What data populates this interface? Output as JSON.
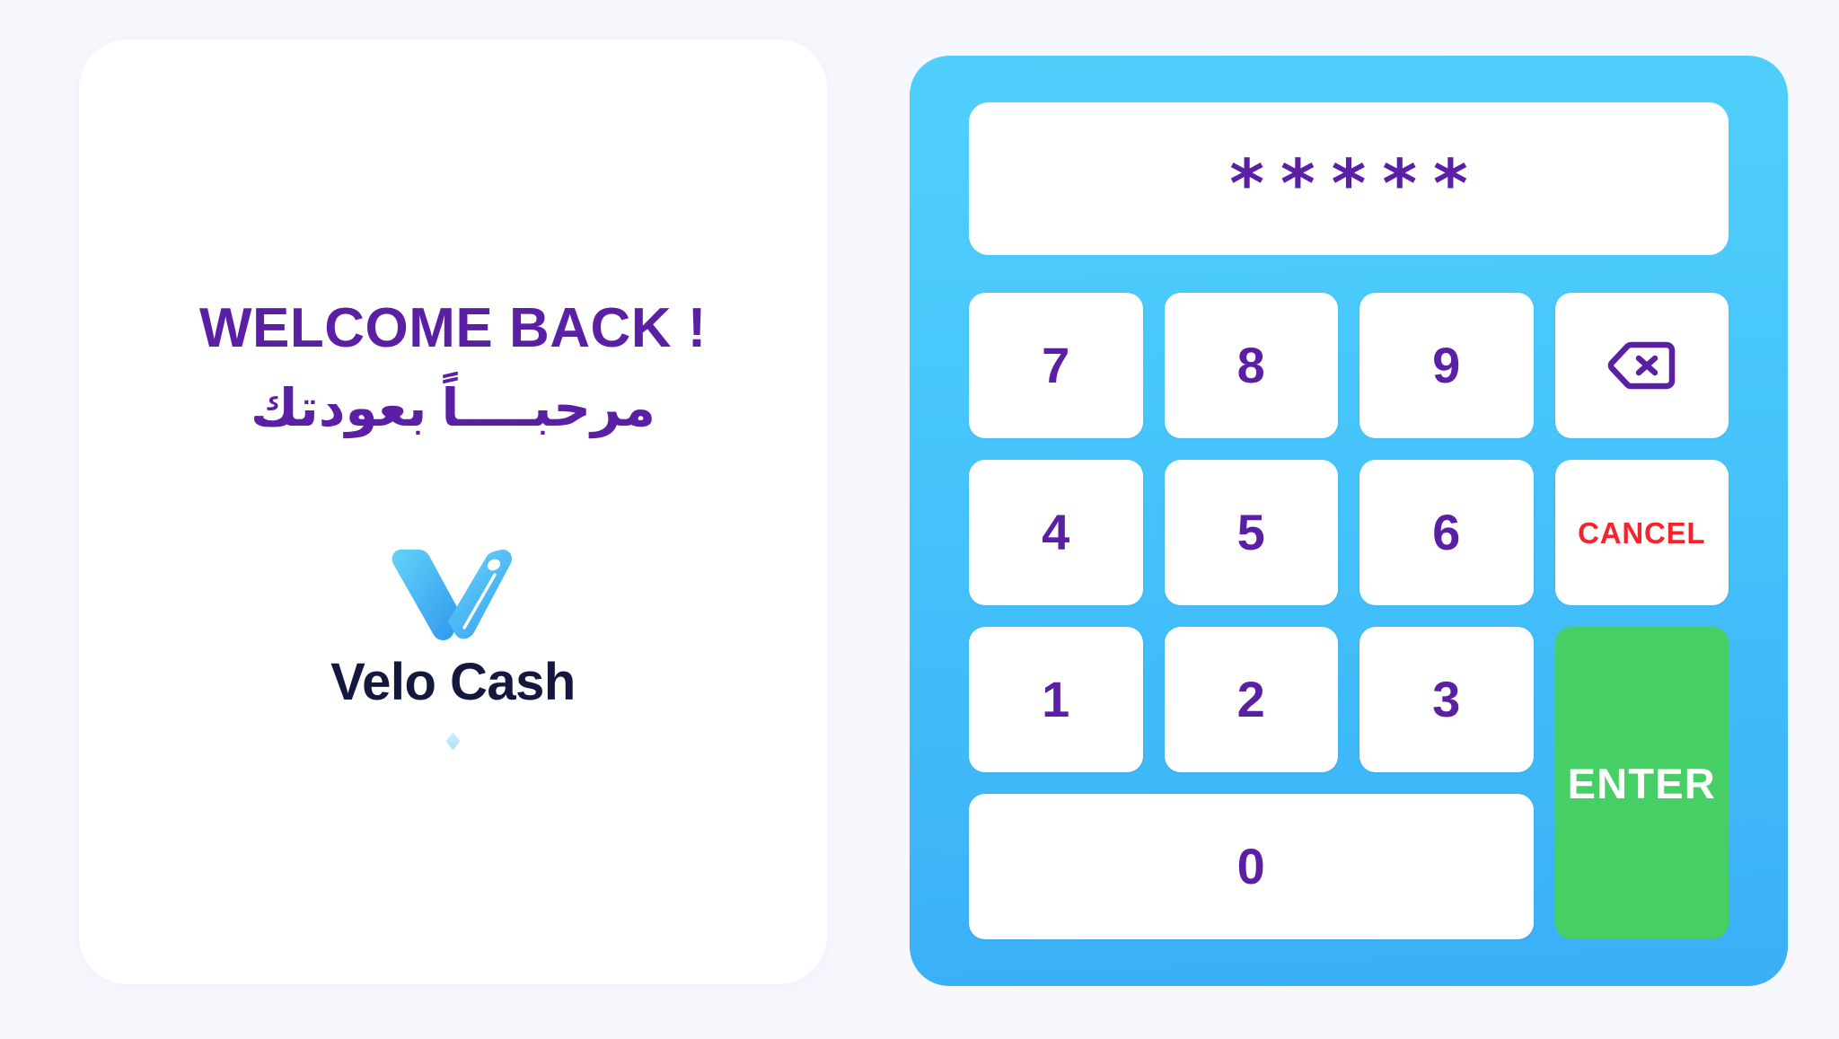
{
  "app": {
    "background_color": "#f6f8fd",
    "brand_purple": "#5b1fa6",
    "panel_blue_top": "#51cffb",
    "panel_blue_bottom": "#3aaff7",
    "enter_green": "#45cf65",
    "cancel_red": "#f4232c",
    "brand_navy": "#14183c"
  },
  "welcome": {
    "title_en": "WELCOME BACK !",
    "title_ar": "مرحبــــاً بعودتك",
    "brand_name": "Velo Cash",
    "logo_icon": "velo-v-wallet-icon"
  },
  "keypad": {
    "pin_display": {
      "masked_value": "*****",
      "digit_count": 5
    },
    "keys": [
      {
        "id": "key-7",
        "label": "7",
        "type": "digit"
      },
      {
        "id": "key-8",
        "label": "8",
        "type": "digit"
      },
      {
        "id": "key-9",
        "label": "9",
        "type": "digit"
      },
      {
        "id": "key-backspace",
        "label": "",
        "type": "backspace",
        "icon": "backspace-icon"
      },
      {
        "id": "key-4",
        "label": "4",
        "type": "digit"
      },
      {
        "id": "key-5",
        "label": "5",
        "type": "digit"
      },
      {
        "id": "key-6",
        "label": "6",
        "type": "digit"
      },
      {
        "id": "key-cancel",
        "label": "CANCEL",
        "type": "action"
      },
      {
        "id": "key-1",
        "label": "1",
        "type": "digit"
      },
      {
        "id": "key-2",
        "label": "2",
        "type": "digit"
      },
      {
        "id": "key-3",
        "label": "3",
        "type": "digit"
      },
      {
        "id": "key-enter",
        "label": "ENTER",
        "type": "action"
      },
      {
        "id": "key-0",
        "label": "0",
        "type": "digit"
      }
    ]
  }
}
